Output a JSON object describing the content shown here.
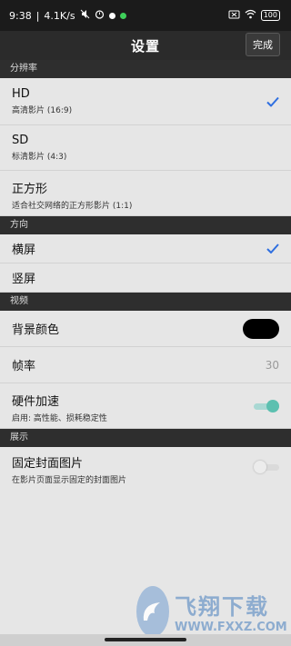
{
  "status_bar": {
    "time": "9:38",
    "network_speed": "4.1K/s",
    "battery": "100",
    "icons": [
      "mute-icon",
      "alarm-icon",
      "white-dot",
      "green-dot",
      "sim-x-icon",
      "wifi-icon",
      "battery-icon"
    ]
  },
  "header": {
    "title": "设置",
    "done_label": "完成"
  },
  "sections": {
    "resolution": {
      "label": "分辨率",
      "options": [
        {
          "title": "HD",
          "subtitle": "高清影片 (16:9)",
          "selected": true
        },
        {
          "title": "SD",
          "subtitle": "标清影片 (4:3)",
          "selected": false
        },
        {
          "title": "正方形",
          "subtitle": "适合社交网络的正方形影片 (1:1)",
          "selected": false
        }
      ]
    },
    "orientation": {
      "label": "方向",
      "options": [
        {
          "title": "横屏",
          "selected": true
        },
        {
          "title": "竖屏",
          "selected": false
        }
      ]
    },
    "video": {
      "label": "视频",
      "background_color_label": "背景颜色",
      "background_color": "#000000",
      "frame_rate_label": "帧率",
      "frame_rate_value": "30",
      "hw_accel_label": "硬件加速",
      "hw_accel_subtitle": "启用: 高性能、损耗稳定性",
      "hw_accel_enabled": true
    },
    "display": {
      "label": "展示",
      "fixed_cover_label": "固定封面图片",
      "fixed_cover_subtitle": "在影片页面显示固定的封面图片",
      "fixed_cover_enabled": false
    }
  },
  "watermark": {
    "title": "飞翔下载",
    "url": "WWW.FXXZ.COM"
  },
  "colors": {
    "accent_check": "#2f6fe0",
    "toggle_on": "#5cc0b0",
    "section_header_bg": "#2e2e2e",
    "nav_bg": "#2b2b2b",
    "list_bg": "#e6e6e6"
  }
}
